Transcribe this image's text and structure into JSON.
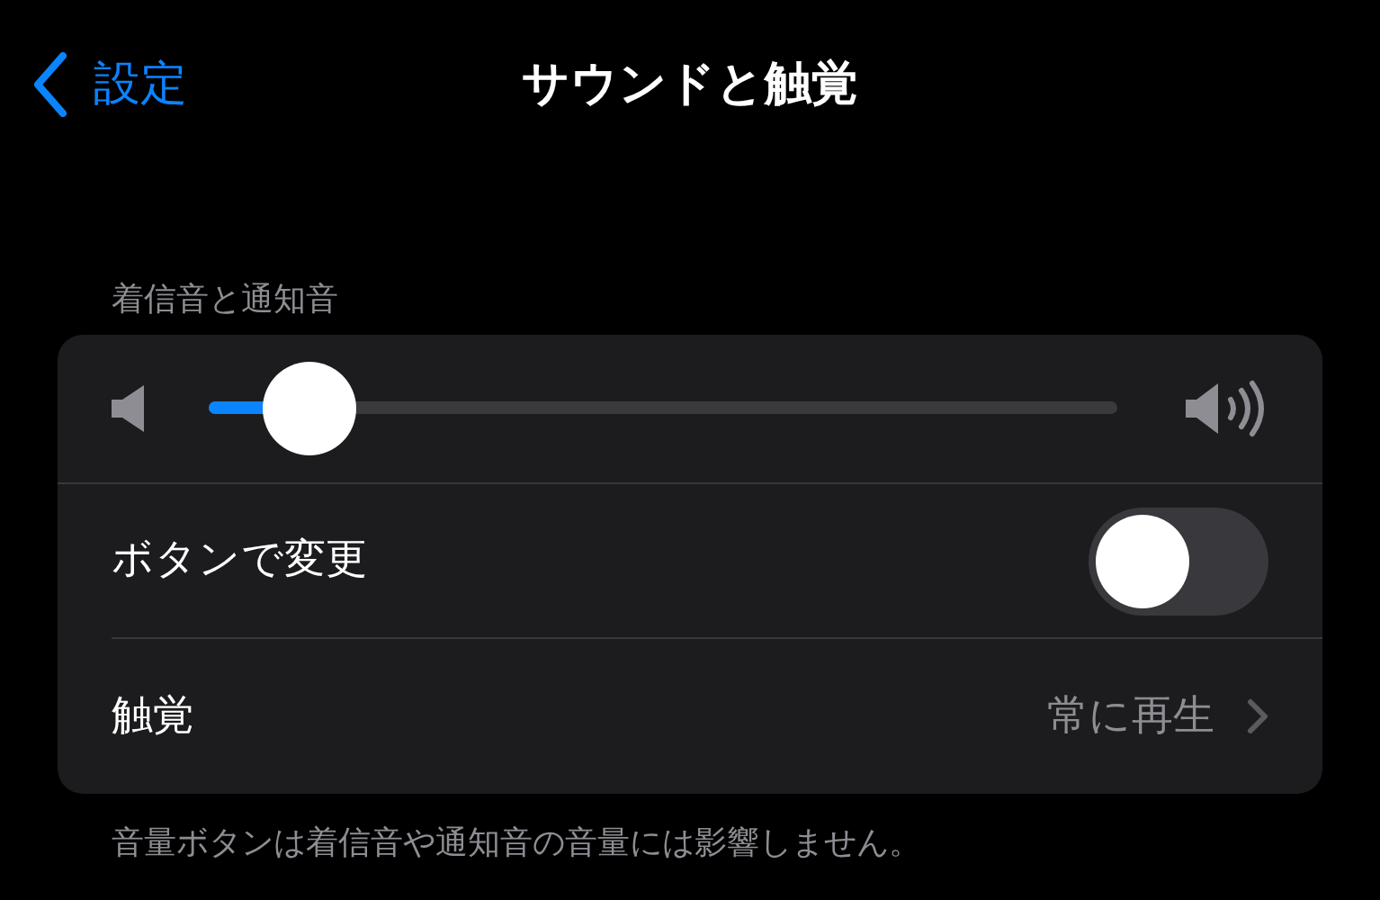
{
  "nav": {
    "back_label": "設定",
    "title": "サウンドと触覚"
  },
  "section": {
    "header": "着信音と通知音",
    "volume": {
      "level": 0.11
    },
    "rows": [
      {
        "kind": "toggle",
        "label": "ボタンで変更",
        "on": false
      },
      {
        "kind": "link",
        "label": "触覚",
        "value": "常に再生"
      }
    ],
    "footer": "音量ボタンは着信音や通知音の音量には影響しません。"
  }
}
